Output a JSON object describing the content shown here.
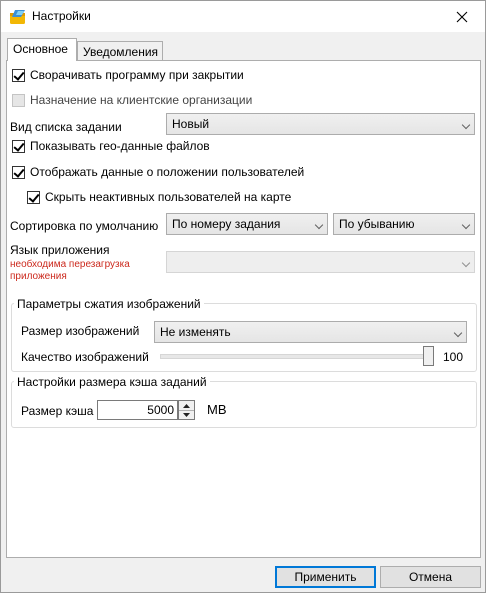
{
  "window": {
    "title": "Настройки"
  },
  "tabs": [
    {
      "label": "Основное",
      "active": true
    },
    {
      "label": "Уведомления",
      "active": false
    }
  ],
  "main": {
    "minimize_on_close": {
      "label": "Сворачивать программу при закрытии",
      "checked": true
    },
    "client_orgs": {
      "label": "Назначение на клиентские организации",
      "checked": false,
      "enabled": false
    },
    "task_list_view": {
      "label": "Вид списка задании",
      "value": "Новый"
    },
    "show_geo": {
      "label": "Показывать гео-данные файлов",
      "checked": true
    },
    "show_user_positions": {
      "label": "Отображать данные о положении пользователей",
      "checked": true
    },
    "hide_inactive": {
      "label": "Скрыть неактивных пользователей на карте",
      "checked": true
    },
    "default_sort": {
      "label": "Сортировка по умолчанию",
      "field": "По номеру задания",
      "order": "По убыванию"
    },
    "language": {
      "label": "Язык приложения",
      "note": "необходима перезагрузка приложения",
      "value": ""
    },
    "image_compression": {
      "title": "Параметры сжатия изображений",
      "size_label": "Размер изображений",
      "size_value": "Не изменять",
      "quality_label": "Качество изображений",
      "quality_value": "100",
      "quality_fraction": 1.0
    },
    "cache": {
      "title": "Настройки размера кэша заданий",
      "size_label": "Размер кэша",
      "size_value": "5000",
      "unit": "MB"
    }
  },
  "buttons": {
    "apply": "Применить",
    "cancel": "Отмена"
  },
  "colors": {
    "note_red": "#cc2a1e",
    "accent": "#0078d7"
  }
}
